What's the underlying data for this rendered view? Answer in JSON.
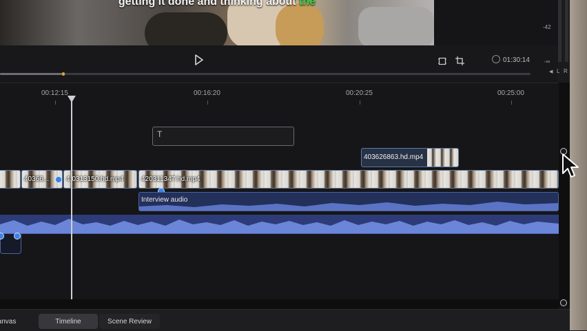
{
  "preview": {
    "caption_text": "getting it done and thinking about",
    "caption_highlight": "the",
    "caption_highlight_color": "#37d43f"
  },
  "controls": {
    "play_icon": "play-icon",
    "time": "01:30:14",
    "scrub_progress": 0.12
  },
  "meter": {
    "label_42": "-42",
    "label_inf": "-∞",
    "left": "L",
    "right": "R"
  },
  "ruler": {
    "labels": [
      "00:12:15",
      "00:16:20",
      "00:20:25",
      "00:25:00"
    ]
  },
  "tracks": {
    "text_clip_label": "T",
    "overlay_clip_name": "403626863.hd.mp4",
    "video_clips": [
      "40366...",
      "4:0313150.hd.mp4",
      "420311347.hd.mp4"
    ],
    "interview_audio_label": "Interview audio"
  },
  "tabs": {
    "canvas": "anvas",
    "timeline": "Timeline",
    "scene_review": "Scene Review"
  },
  "colors": {
    "accent_blue": "#3b82e6",
    "audio_fill": "#2d3c78"
  }
}
